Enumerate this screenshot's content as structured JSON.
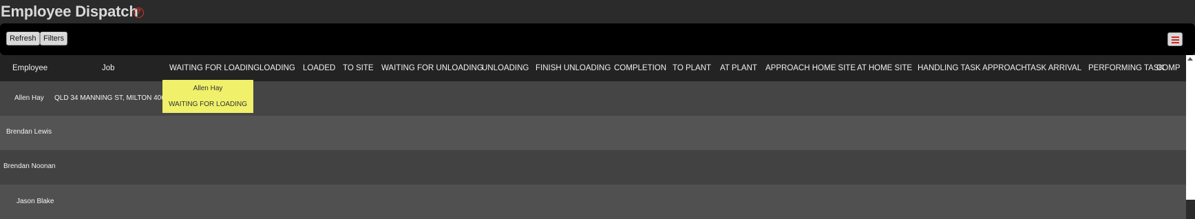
{
  "header": {
    "title": "Employee Dispatch"
  },
  "toolbar": {
    "refresh_label": "Refresh",
    "filters_label": "Filters"
  },
  "columns": [
    "Employee",
    "Job",
    "WAITING FOR LOADING",
    "LOADING",
    "LOADED",
    "TO SITE",
    "WAITING FOR UNLOADING",
    "UNLOADING",
    "FINISH UNLOADING",
    "COMPLETION",
    "TO PLANT",
    "AT PLANT",
    "APPROACH HOME SITE",
    "AT HOME SITE",
    "HANDLING TASK APPROACH",
    "TASK ARRIVAL",
    "PERFORMING TASK",
    "COMP"
  ],
  "rows": [
    {
      "employee": "Allen Hay",
      "job": "QLD 34 MANNING ST, MILTON 4064"
    },
    {
      "employee": "Brendan Lewis",
      "job": ""
    },
    {
      "employee": "Brendan Noonan",
      "job": ""
    },
    {
      "employee": "Jason Blake",
      "job": ""
    }
  ],
  "card": {
    "employee": "Allen Hay",
    "status": "WAITING FOR LOADING",
    "color": "#f0f06a"
  },
  "colors": {
    "accent": "#e0302a",
    "toolbar_bg": "#000000",
    "page_bg": "#2b2b2b"
  },
  "icons": {
    "help": "help-circle-icon",
    "menu": "hamburger-menu-icon"
  }
}
